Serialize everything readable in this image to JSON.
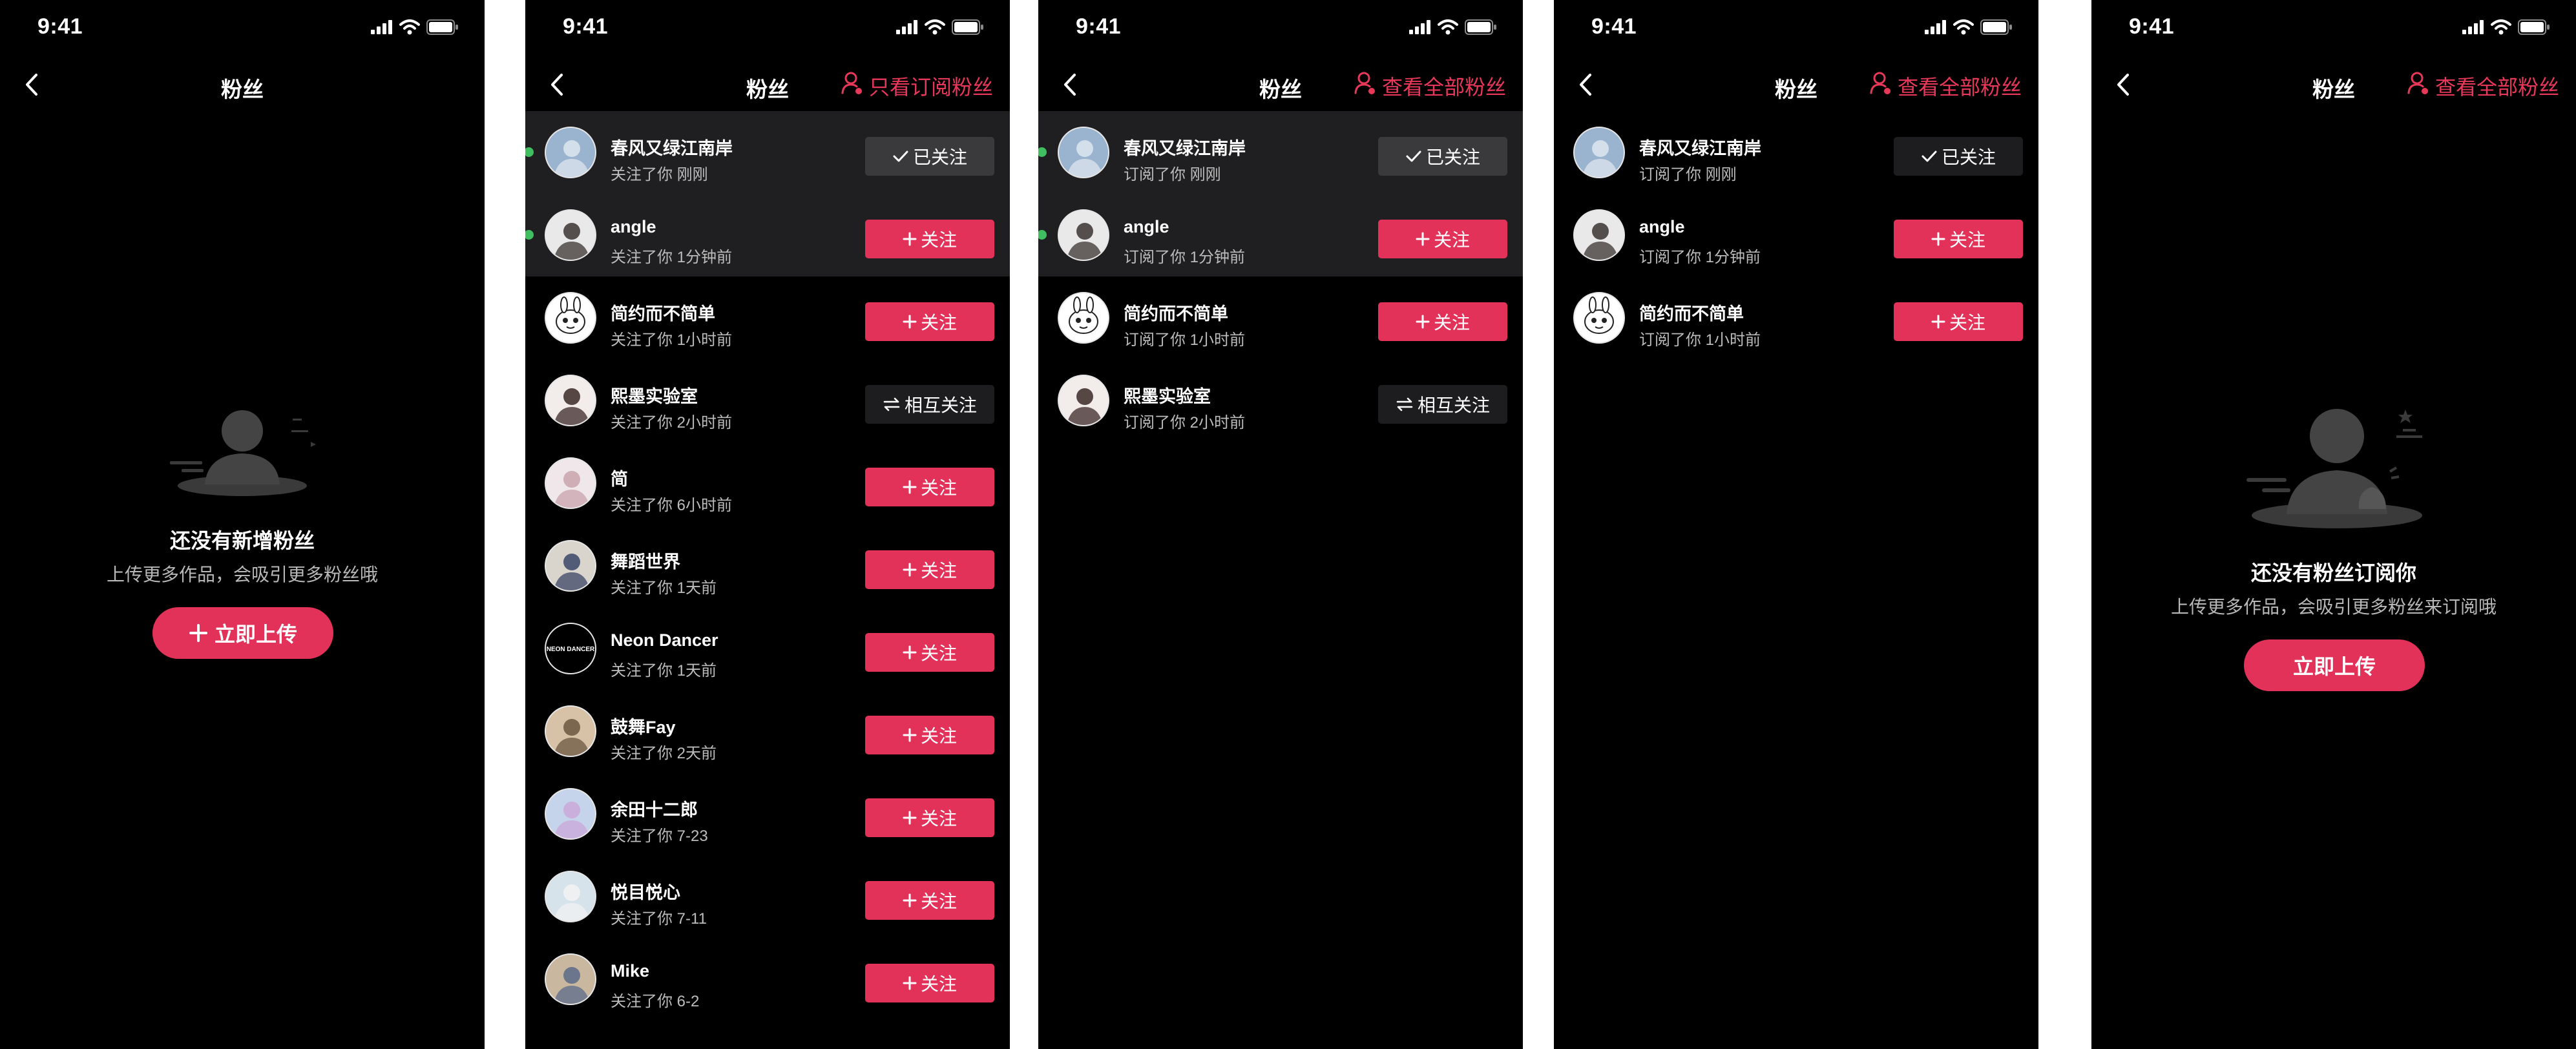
{
  "status_time": "9:41",
  "colors": {
    "accent": "#e3325a",
    "online": "#3fbf5f",
    "background": "#000000"
  },
  "screens": [
    {
      "id": "empty-fans",
      "title": "粉丝",
      "empty_title": "还没有新增粉丝",
      "empty_subtitle": "上传更多作品，会吸引更多粉丝哦",
      "button_label": "立即上传",
      "button_icon": "plus-icon"
    },
    {
      "id": "fans-all",
      "title": "粉丝",
      "filter_label": "只看订阅粉丝",
      "filter_icon": "user-filter-icon",
      "rows": [
        {
          "name": "春风又绿江南岸",
          "sub": "关注了你  刚刚",
          "button": "已关注",
          "state": "followed",
          "highlight": true,
          "online": true
        },
        {
          "name": "angle",
          "sub": "关注了你  1分钟前",
          "button": "关注",
          "state": "follow",
          "highlight": true,
          "online": true
        },
        {
          "name": "简约而不简单",
          "sub": "关注了你  1小时前",
          "button": "关注",
          "state": "follow"
        },
        {
          "name": "熙墨实验室",
          "sub": "关注了你  2小时前",
          "button": "相互关注",
          "state": "mutual"
        },
        {
          "name": "简",
          "sub": "关注了你  6小时前",
          "button": "关注",
          "state": "follow"
        },
        {
          "name": "舞蹈世界",
          "sub": "关注了你  1天前",
          "button": "关注",
          "state": "follow"
        },
        {
          "name": "Neon Dancer",
          "sub": "关注了你  1天前",
          "button": "关注",
          "state": "follow",
          "avatar_text": "NEON DANCER"
        },
        {
          "name": "鼓舞Fay",
          "sub": "关注了你  2天前",
          "button": "关注",
          "state": "follow"
        },
        {
          "name": "余田十二郎",
          "sub": "关注了你  7-23",
          "button": "关注",
          "state": "follow"
        },
        {
          "name": "悦目悦心",
          "sub": "关注了你  7-11",
          "button": "关注",
          "state": "follow"
        },
        {
          "name": "Mike",
          "sub": "关注了你  6-2",
          "button": "关注",
          "state": "follow"
        }
      ]
    },
    {
      "id": "subscribed-fans",
      "title": "粉丝",
      "filter_label": "查看全部粉丝",
      "filter_icon": "user-filter-icon",
      "rows": [
        {
          "name": "春风又绿江南岸",
          "sub": "订阅了你  刚刚",
          "button": "已关注",
          "state": "followed",
          "highlight": true,
          "online": true
        },
        {
          "name": "angle",
          "sub": "订阅了你  1分钟前",
          "button": "关注",
          "state": "follow",
          "highlight": true,
          "online": true
        },
        {
          "name": "简约而不简单",
          "sub": "订阅了你  1小时前",
          "button": "关注",
          "state": "follow"
        },
        {
          "name": "熙墨实验室",
          "sub": "订阅了你  2小时前",
          "button": "相互关注",
          "state": "mutual"
        }
      ]
    },
    {
      "id": "subscribed-fans-read",
      "title": "粉丝",
      "filter_label": "查看全部粉丝",
      "filter_icon": "user-filter-icon",
      "rows": [
        {
          "name": "春风又绿江南岸",
          "sub": "订阅了你  刚刚",
          "button": "已关注",
          "state": "followed-dark"
        },
        {
          "name": "angle",
          "sub": "订阅了你  1分钟前",
          "button": "关注",
          "state": "follow"
        },
        {
          "name": "简约而不简单",
          "sub": "订阅了你  1小时前",
          "button": "关注",
          "state": "follow"
        }
      ]
    },
    {
      "id": "empty-subscribers",
      "title": "粉丝",
      "filter_label": "查看全部粉丝",
      "filter_icon": "user-filter-icon",
      "empty_title": "还没有粉丝订阅你",
      "empty_subtitle": "上传更多作品，会吸引更多粉丝来订阅哦",
      "button_label": "立即上传"
    }
  ]
}
